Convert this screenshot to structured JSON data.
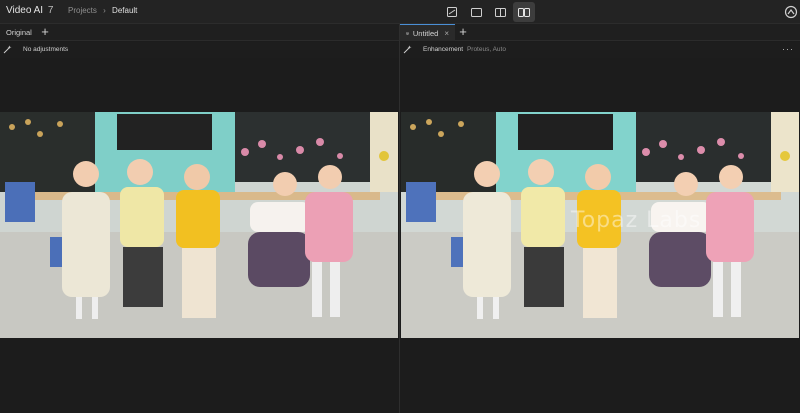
{
  "app": {
    "name": "Video AI",
    "version": "7"
  },
  "breadcrumb": {
    "projects": "Projects",
    "separator": "›",
    "current": "Default"
  },
  "view_modes": [
    "single-view-icon",
    "split-horizontal-icon",
    "split-vertical-icon",
    "side-by-side-icon"
  ],
  "active_view": "side-by-side-icon",
  "left_panel": {
    "tab_label": "Original",
    "add_label": "+",
    "status": "No adjustments"
  },
  "right_panel": {
    "tab_label": "Untitled",
    "tab_close": "×",
    "add_label": "+",
    "status_label": "Enhancement",
    "status_detail": "Proteus, Auto",
    "more_label": "···",
    "watermark": "Topaz Labs"
  },
  "colors": {
    "accent": "#4a8fd6",
    "background": "#1c1c1c"
  }
}
